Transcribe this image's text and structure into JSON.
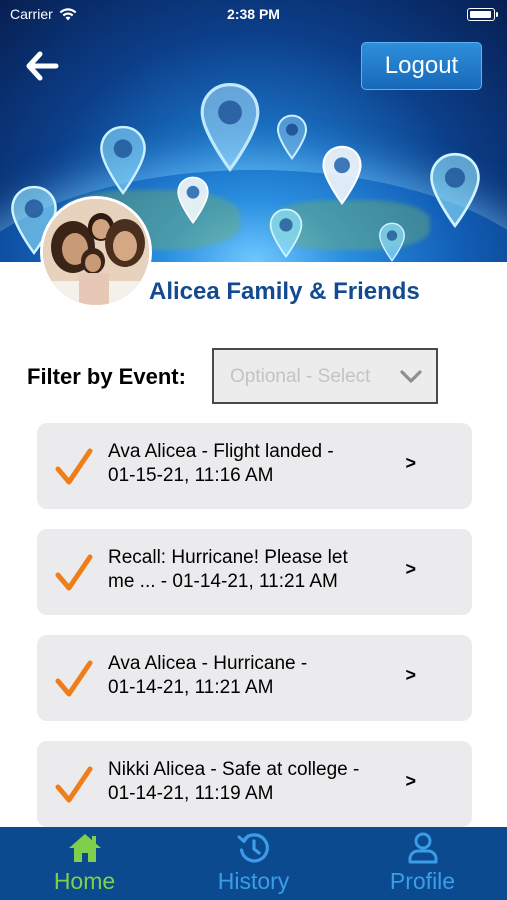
{
  "status_bar": {
    "carrier": "Carrier",
    "time": "2:38 PM"
  },
  "header": {
    "logout_label": "Logout",
    "group_title": "Alicea Family & Friends"
  },
  "filter": {
    "label": "Filter by Event:",
    "placeholder": "Optional - Select"
  },
  "events": [
    {
      "line1": "Ava  Alicea - Flight landed -",
      "line2": "01-15-21, 11:16 AM",
      "arrow": ">"
    },
    {
      "line1": "Recall: Hurricane! Please let",
      "line2": "me ... - 01-14-21, 11:21 AM",
      "arrow": ">"
    },
    {
      "line1": "Ava  Alicea - Hurricane -",
      "line2": "01-14-21, 11:21 AM",
      "arrow": ">"
    },
    {
      "line1": "Nikki Alicea - Safe at college -",
      "line2": "01-14-21, 11:19 AM",
      "arrow": ">"
    }
  ],
  "tabs": [
    {
      "label": "Home",
      "icon": "home-icon"
    },
    {
      "label": "History",
      "icon": "history-icon"
    },
    {
      "label": "Profile",
      "icon": "profile-icon"
    }
  ],
  "colors": {
    "accent_green": "#7ed04c",
    "tab_bar": "#0b4a8f",
    "title_blue": "#134a92",
    "check_orange": "#ef7d1a"
  }
}
